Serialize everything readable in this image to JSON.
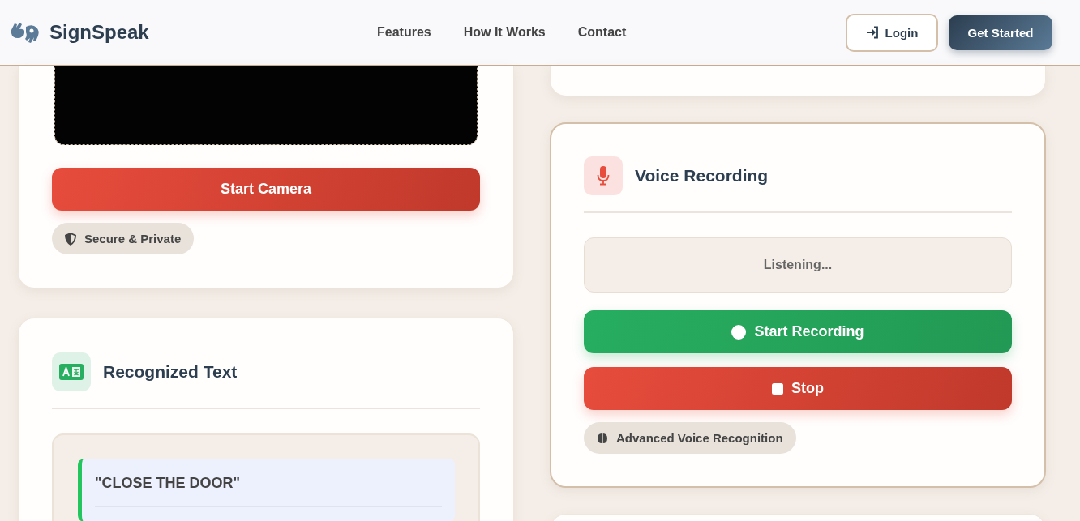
{
  "header": {
    "brand": "SignSpeak",
    "nav": [
      {
        "label": "Features"
      },
      {
        "label": "How It Works"
      },
      {
        "label": "Contact"
      }
    ],
    "login": "Login",
    "cta": "Get Started"
  },
  "camera_card": {
    "button": "Start Camera",
    "badge": "Secure & Private"
  },
  "text_card": {
    "title": "Recognized Text",
    "results": [
      {
        "text": "\"CLOSE THE DOOR\""
      }
    ]
  },
  "voice_card": {
    "title": "Voice Recording",
    "status": "Listening...",
    "buttons": [
      {
        "label": "Start Recording",
        "kind": "start"
      },
      {
        "label": "Stop",
        "kind": "stop"
      }
    ],
    "badge": "Advanced Voice Recognition"
  }
}
